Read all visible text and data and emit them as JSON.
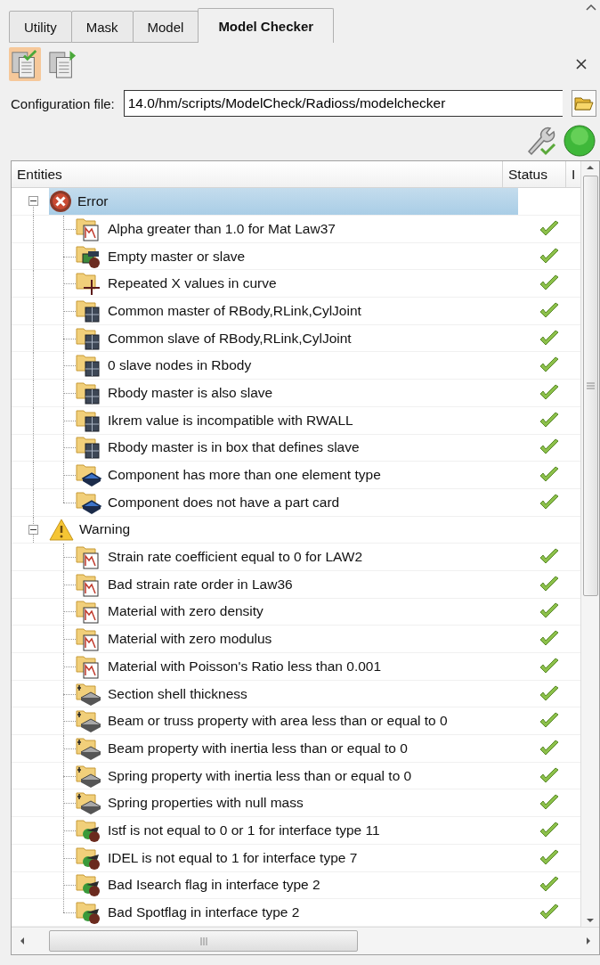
{
  "tabs": [
    {
      "label": "Utility",
      "selected": false
    },
    {
      "label": "Mask",
      "selected": false
    },
    {
      "label": "Model",
      "selected": false
    },
    {
      "label": "Model Checker",
      "selected": true
    }
  ],
  "toolbar": {
    "buttons": [
      {
        "kind": "check-doc",
        "active": true
      },
      {
        "kind": "run-doc",
        "active": false
      }
    ]
  },
  "config": {
    "label": "Configuration file:",
    "value": "14.0/hm/scripts/ModelCheck/Radioss/modelchecker"
  },
  "tree": {
    "columns": [
      {
        "label": "Entities"
      },
      {
        "label": "Status"
      },
      {
        "label": "I"
      }
    ],
    "groups": [
      {
        "label": "Error",
        "kind": "error",
        "expanded": true,
        "selected": true,
        "children": [
          {
            "label": "Alpha greater than 1.0 for Mat Law37",
            "kind": "material",
            "passed": true
          },
          {
            "label": "Empty master or slave",
            "kind": "contact",
            "passed": true
          },
          {
            "label": "Repeated X values in curve",
            "kind": "curve",
            "passed": true
          },
          {
            "label": "Common master of RBody,RLink,CylJoint",
            "kind": "rbody",
            "passed": true
          },
          {
            "label": "Common slave of RBody,RLink,CylJoint",
            "kind": "rbody",
            "passed": true
          },
          {
            "label": "0 slave nodes in Rbody",
            "kind": "rbody",
            "passed": true
          },
          {
            "label": "Rbody master is also slave",
            "kind": "rbody",
            "passed": true
          },
          {
            "label": "Ikrem value is incompatible with RWALL",
            "kind": "rbody",
            "passed": true
          },
          {
            "label": "Rbody master is in box that defines slave",
            "kind": "rbody",
            "passed": true
          },
          {
            "label": "Component has more than one element type",
            "kind": "component",
            "passed": true
          },
          {
            "label": "Component does not have a part card",
            "kind": "component",
            "passed": true
          }
        ]
      },
      {
        "label": "Warning",
        "kind": "warning",
        "expanded": true,
        "selected": false,
        "children": [
          {
            "label": "Strain rate coefficient equal to 0 for LAW2",
            "kind": "material",
            "passed": true
          },
          {
            "label": "Bad strain rate order in Law36",
            "kind": "material",
            "passed": true
          },
          {
            "label": "Material with zero density",
            "kind": "material",
            "passed": true
          },
          {
            "label": "Material with zero modulus",
            "kind": "material",
            "passed": true
          },
          {
            "label": "Material with Poisson's Ratio less than 0.001",
            "kind": "material",
            "passed": true
          },
          {
            "label": "Section shell thickness",
            "kind": "property",
            "passed": true
          },
          {
            "label": "Beam or truss property with area less than or equal to 0",
            "kind": "property",
            "passed": true
          },
          {
            "label": "Beam property with inertia less than or equal to 0",
            "kind": "property",
            "passed": true
          },
          {
            "label": "Spring property with inertia less than or equal to 0",
            "kind": "property",
            "passed": true
          },
          {
            "label": "Spring properties with null mass",
            "kind": "property",
            "passed": true
          },
          {
            "label": "Istf is not equal to 0 or 1 for interface type 11",
            "kind": "interface",
            "passed": true
          },
          {
            "label": "IDEL is not equal to 1 for interface type 7",
            "kind": "interface",
            "passed": true
          },
          {
            "label": "Bad Isearch flag in interface type 2",
            "kind": "interface",
            "passed": true
          },
          {
            "label": "Bad Spotflag in interface type 2",
            "kind": "interface",
            "passed": true
          }
        ]
      }
    ]
  }
}
